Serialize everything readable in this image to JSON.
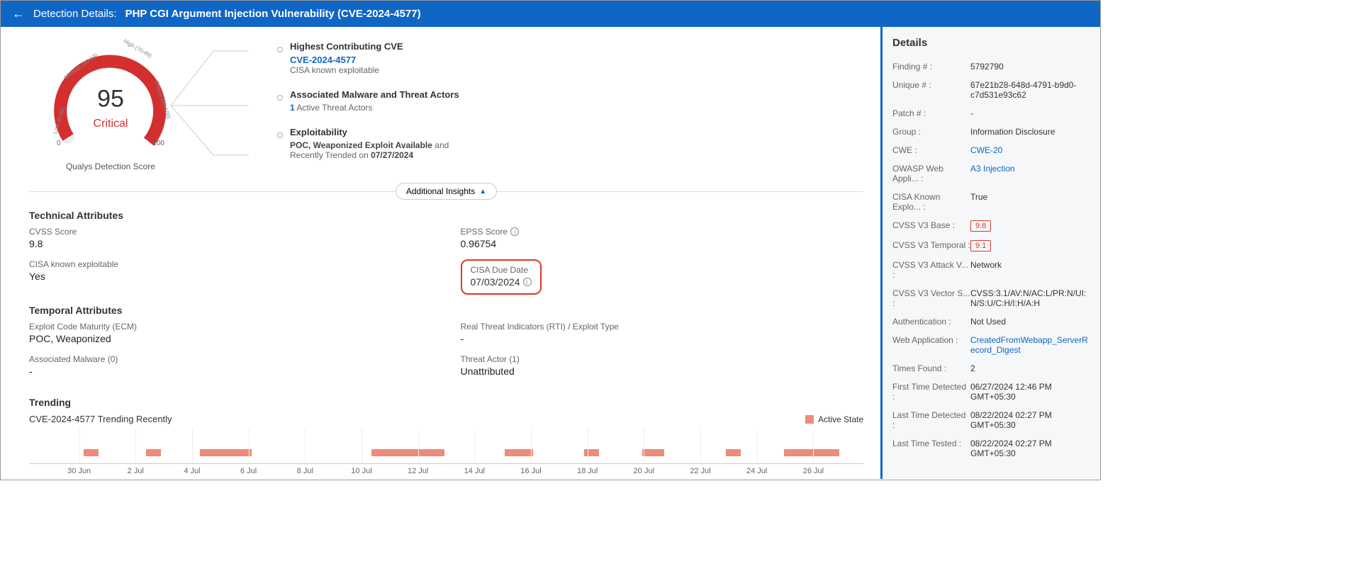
{
  "header": {
    "label": "Detection Details:",
    "title": "PHP CGI Argument Injection Vulnerability (CVE-2024-4577)"
  },
  "gauge": {
    "score": "95",
    "status": "Critical",
    "caption": "Qualys Detection Score",
    "tick_low": "0",
    "tick_high": "100",
    "arc_low": "Low (0-39)",
    "arc_med": "Medium (40-69)",
    "arc_high": "High (70-89)",
    "arc_crit": "Critical (90-100)"
  },
  "insights": {
    "cve_section": {
      "title": "Highest Contributing CVE",
      "cve": "CVE-2024-4577",
      "sub": "CISA known exploitable"
    },
    "malware_section": {
      "title": "Associated Malware and Threat Actors",
      "count": "1",
      "sub": "Active Threat Actors"
    },
    "exploit_section": {
      "title": "Exploitability",
      "line1a": "POC, Weaponized Exploit Available",
      "line1b": " and",
      "line2a": "Recently Trended on ",
      "line2b": "07/27/2024"
    },
    "toggle": "Additional Insights"
  },
  "technical": {
    "title": "Technical Attributes",
    "cvss_label": "CVSS Score",
    "cvss_val": "9.8",
    "epss_label": "EPSS Score",
    "epss_val": "0.96754",
    "cisa_known_label": "CISA known exploitable",
    "cisa_known_val": "Yes",
    "cisa_due_label": "CISA Due Date",
    "cisa_due_val": "07/03/2024"
  },
  "temporal": {
    "title": "Temporal Attributes",
    "ecm_label": "Exploit Code Maturity (ECM)",
    "ecm_val": "POC, Weaponized",
    "rti_label": "Real Threat Indicators (RTI) / Exploit Type",
    "rti_val": "-",
    "malware_label": "Associated Malware (0)",
    "malware_val": "-",
    "actor_label": "Threat Actor (1)",
    "actor_val": "Unattributed"
  },
  "trending": {
    "title": "Trending",
    "sub": "CVE-2024-4577 Trending Recently",
    "legend": "Active State",
    "ticks": [
      "30 Jun",
      "2 Jul",
      "4 Jul",
      "6 Jul",
      "8 Jul",
      "10 Jul",
      "12 Jul",
      "14 Jul",
      "16 Jul",
      "18 Jul",
      "20 Jul",
      "22 Jul",
      "24 Jul",
      "26 Jul"
    ]
  },
  "chart_data": {
    "type": "bar",
    "x_axis_dates": [
      "30 Jun",
      "2 Jul",
      "4 Jul",
      "6 Jul",
      "8 Jul",
      "10 Jul",
      "12 Jul",
      "14 Jul",
      "16 Jul",
      "18 Jul",
      "20 Jul",
      "22 Jul",
      "24 Jul",
      "26 Jul"
    ],
    "series": [
      {
        "name": "Active State",
        "intervals_pct": [
          {
            "start": 6.5,
            "width": 1.8
          },
          {
            "start": 14.0,
            "width": 1.8
          },
          {
            "start": 20.5,
            "width": 6.2
          },
          {
            "start": 41.0,
            "width": 8.8
          },
          {
            "start": 57.0,
            "width": 3.4
          },
          {
            "start": 66.5,
            "width": 1.8
          },
          {
            "start": 73.5,
            "width": 2.6
          },
          {
            "start": 83.5,
            "width": 1.8
          },
          {
            "start": 90.5,
            "width": 6.6
          }
        ]
      }
    ]
  },
  "details": {
    "title": "Details",
    "rows": [
      {
        "label": "Finding # :",
        "val": "5792790"
      },
      {
        "label": "Unique # :",
        "val": "67e21b28-648d-4791-b9d0-c7d531e93c62"
      },
      {
        "label": "Patch # :",
        "val": "-"
      },
      {
        "label": "Group :",
        "val": "Information Disclosure"
      },
      {
        "label": "CWE :",
        "val": "CWE-20",
        "link": true
      },
      {
        "label": "OWASP Web Appli... :",
        "val": "A3 Injection",
        "link": true
      },
      {
        "label": "CISA Known Explo... :",
        "val": "True"
      },
      {
        "label": "CVSS V3 Base :",
        "val": "9.8",
        "badge": true
      },
      {
        "label": "CVSS V3 Temporal :",
        "val": "9.1",
        "badge": true
      },
      {
        "label": "CVSS V3 Attack V... :",
        "val": "Network"
      },
      {
        "label": "CVSS V3 Vector S... :",
        "val": "CVSS:3.1/AV:N/AC:L/PR:N/UI:N/S:U/C:H/I:H/A:H"
      },
      {
        "label": "Authentication :",
        "val": "Not Used"
      },
      {
        "label": "Web Application :",
        "val": "CreatedFromWebapp_ServerRecord_Digest",
        "link": true
      },
      {
        "label": "Times Found :",
        "val": "2"
      },
      {
        "label": "First Time Detected :",
        "val": "06/27/2024 12:46 PM GMT+05:30"
      },
      {
        "label": "Last Time Detected :",
        "val": "08/22/2024 02:27 PM GMT+05:30"
      },
      {
        "label": "Last Time Tested :",
        "val": "08/22/2024 02:27 PM GMT+05:30"
      }
    ]
  }
}
